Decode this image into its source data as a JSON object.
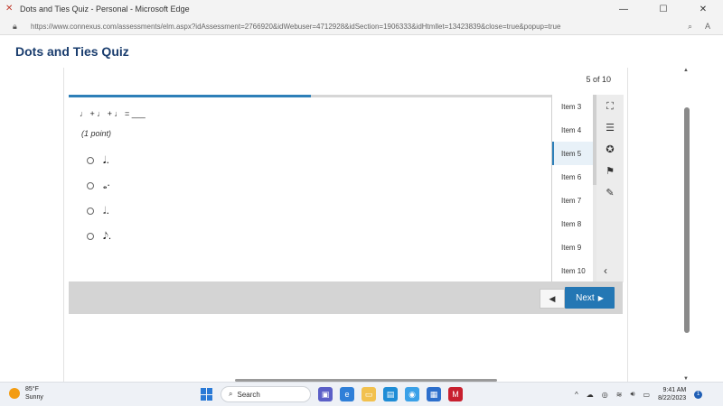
{
  "window": {
    "title": "Dots and Ties Quiz - Personal - Microsoft Edge",
    "minimize": "—",
    "maximize": "☐",
    "close": "✕"
  },
  "address": {
    "url": "https://www.connexus.com/assessments/elm.aspx?idAssessment=2766920&idWebuser=4712928&idSection=1906333&idHtmllet=13423839&close=true&popup=true"
  },
  "page": {
    "quiz_title": "Dots and Ties Quiz",
    "progress_text": "5 of 10",
    "progress_fraction": 0.5,
    "question": "♩ + ♩ + ♩ = ___",
    "points": "(1 point)",
    "options": [
      "𝅘𝅥.",
      "𝅝·",
      "𝅗𝅥.",
      "𝅘𝅥𝅮."
    ],
    "items": [
      "Item 3",
      "Item 4",
      "Item 5",
      "Item 6",
      "Item 7",
      "Item 8",
      "Item 9",
      "Item 10"
    ],
    "active_item": "Item 5",
    "next_label": "Next",
    "next_arrow": "▶",
    "prev_arrow": "◀",
    "collapse": "‹"
  },
  "taskbar": {
    "temperature": "85°F",
    "condition": "Sunny",
    "search_label": "Search",
    "time": "9:41 AM",
    "date": "8/22/2023",
    "badge": "1"
  }
}
